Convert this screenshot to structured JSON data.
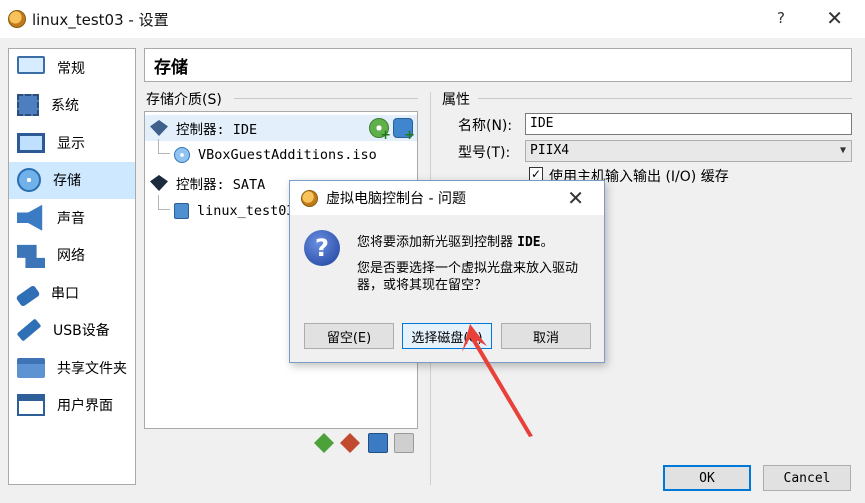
{
  "window": {
    "title": "linux_test03 - 设置",
    "help_glyph": "?",
    "close_glyph": "✕"
  },
  "sidebar": {
    "items": [
      {
        "label": "常规",
        "icon": "general-icon"
      },
      {
        "label": "系统",
        "icon": "system-icon"
      },
      {
        "label": "显示",
        "icon": "display-icon"
      },
      {
        "label": "存储",
        "icon": "storage-icon",
        "active": true
      },
      {
        "label": "声音",
        "icon": "audio-icon"
      },
      {
        "label": "网络",
        "icon": "network-icon"
      },
      {
        "label": "串口",
        "icon": "serial-port-icon"
      },
      {
        "label": "USB设备",
        "icon": "usb-icon"
      },
      {
        "label": "共享文件夹",
        "icon": "shared-folder-icon"
      },
      {
        "label": "用户界面",
        "icon": "user-interface-icon"
      }
    ]
  },
  "header": {
    "title": "存储"
  },
  "storage": {
    "group_label": "存储介质(S)",
    "tree": [
      {
        "label": "控制器: IDE",
        "type": "controller"
      },
      {
        "label": "VBoxGuestAdditions.iso",
        "type": "optical"
      },
      {
        "label": "控制器: SATA",
        "type": "controller"
      },
      {
        "label": "linux_test03",
        "type": "disk"
      }
    ]
  },
  "properties": {
    "group_label": "属性",
    "name_label": "名称(N):",
    "name_value": "IDE",
    "type_label": "型号(T):",
    "type_value": "PIIX4",
    "cache_label": "使用主机输入输出 (I/O) 缓存",
    "cache_checked": "✓"
  },
  "buttons": {
    "ok": "OK",
    "cancel": "Cancel"
  },
  "dialog": {
    "title": "虚拟电脑控制台 - 问题",
    "icon_glyph": "?",
    "message_prefix": "您将要添加新光驱到控制器 ",
    "message_bold": "IDE",
    "message_suffix": "。",
    "question": "您是否要选择一个虚拟光盘来放入驱动器，或将其现在留空？",
    "leave_empty": "留空(E)",
    "choose_disk": "选择磁盘(C)",
    "cancel": "取消"
  },
  "colors": {
    "selection": "#cde8ff",
    "accent": "#0078d7",
    "arrow": "#e8413a"
  }
}
